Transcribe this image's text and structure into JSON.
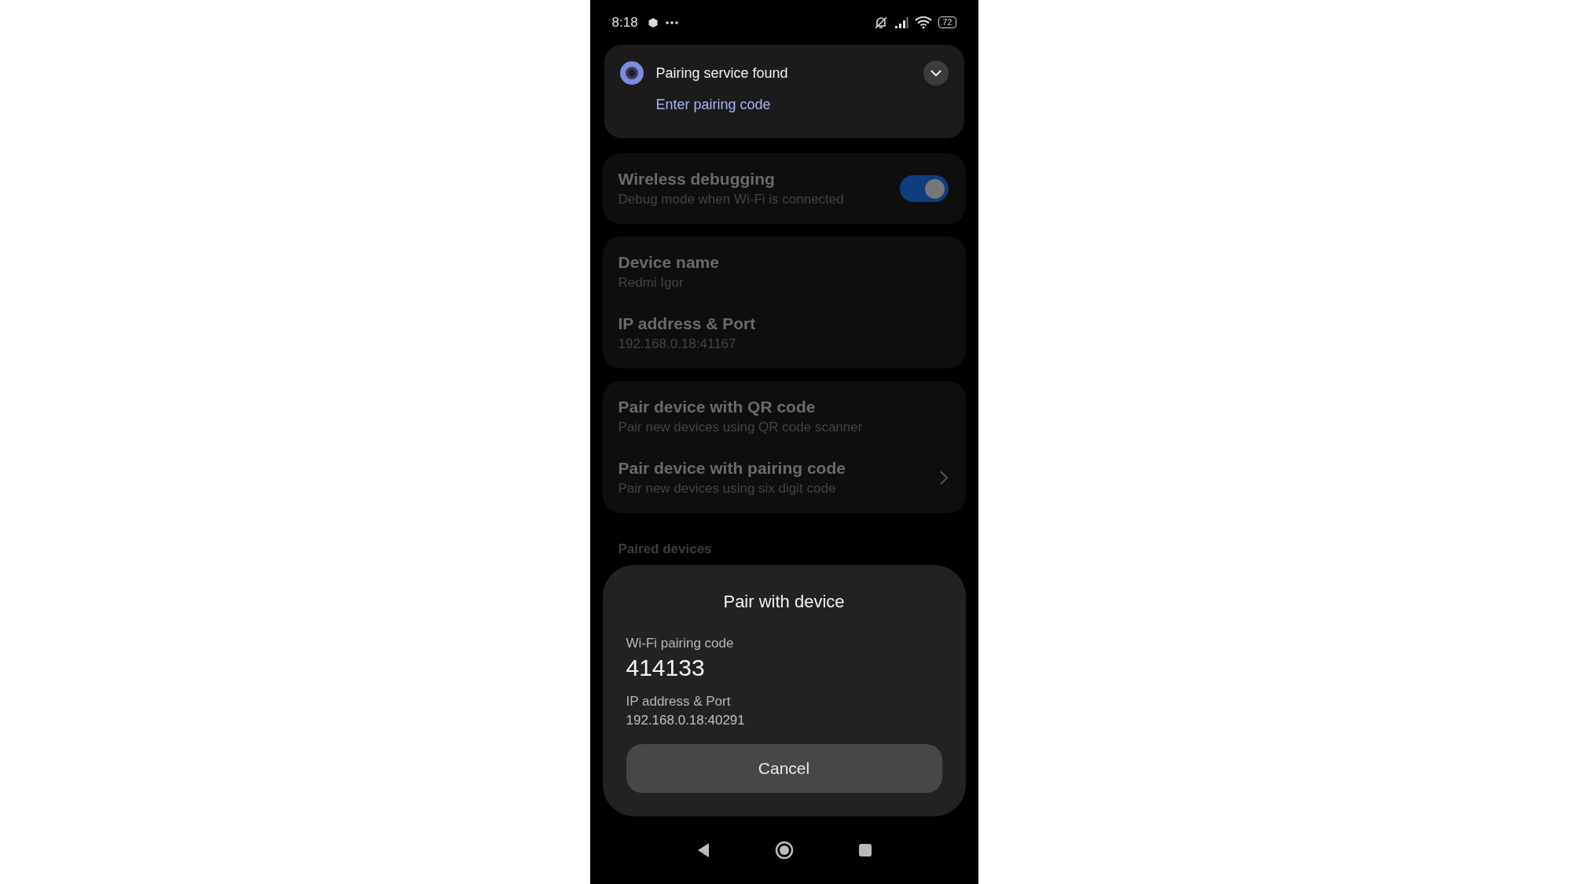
{
  "status_bar": {
    "time": "8:18",
    "battery": "72"
  },
  "notification": {
    "title": "Pairing service found",
    "action": "Enter pairing code"
  },
  "settings_groups": [
    {
      "items": [
        {
          "kind": "toggle",
          "title": "Wireless debugging",
          "subtitle": "Debug mode when Wi-Fi is connected",
          "on": true
        }
      ]
    },
    {
      "items": [
        {
          "kind": "info",
          "title": "Device name",
          "subtitle": "Redmi Igor"
        },
        {
          "kind": "info",
          "title": "IP address & Port",
          "subtitle": "192.168.0.18:41167"
        }
      ]
    },
    {
      "items": [
        {
          "kind": "info",
          "title": "Pair device with QR code",
          "subtitle": "Pair new devices using QR code scanner"
        },
        {
          "kind": "link",
          "title": "Pair device with pairing code",
          "subtitle": "Pair new devices using six digit code"
        }
      ]
    }
  ],
  "section_header": "Paired devices",
  "dialog": {
    "title": "Pair with device",
    "fields": [
      {
        "kind": "code",
        "label": "Wi-Fi pairing code",
        "value": "414133"
      },
      {
        "kind": "plain",
        "label": "IP address & Port",
        "value": "192.168.0.18:40291"
      }
    ],
    "button": "Cancel"
  }
}
